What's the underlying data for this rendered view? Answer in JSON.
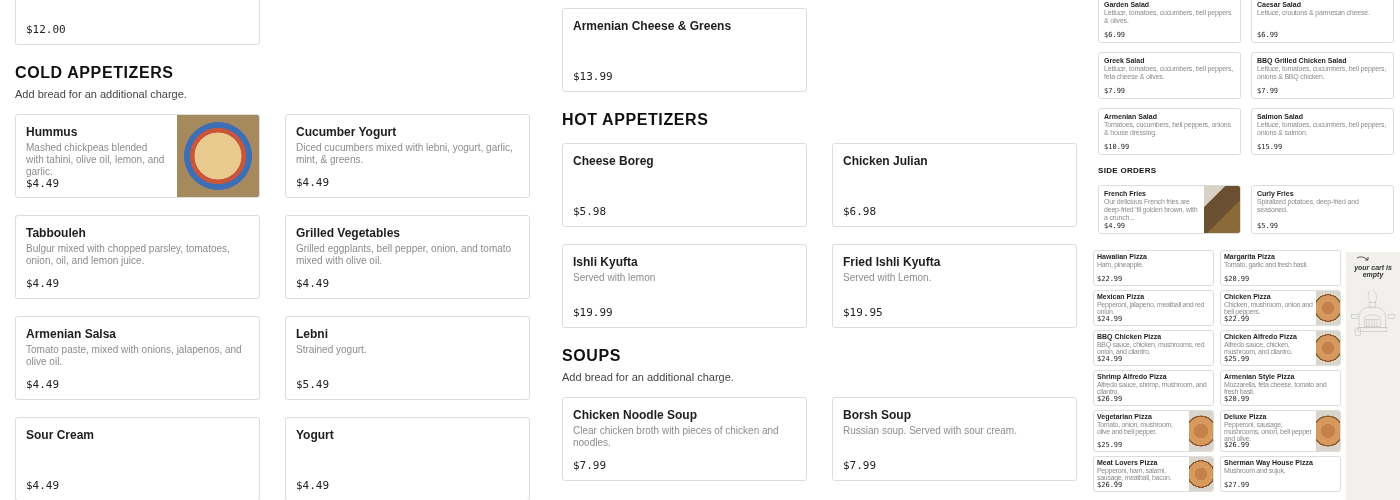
{
  "left_column": [
    {
      "items": [
        {
          "price": "$12.00",
          "photo": false
        }
      ]
    },
    {
      "heading": "COLD APPETIZERS",
      "note": "Add bread for an additional charge.",
      "items": [
        {
          "name": "Hummus",
          "description": "Mashed chickpeas blended with tahini, olive oil, lemon, and garlic.",
          "price": "$4.49",
          "photo": true
        },
        {
          "name": "Cucumber Yogurt",
          "description": "Diced cucumbers mixed with lebni, yogurt, garlic, mint, & greens.",
          "price": "$4.49",
          "photo": false
        },
        {
          "name": "Tabbouleh",
          "description": "Bulgur mixed with chopped parsley, tomatoes, onion, oil, and lemon juice.",
          "price": "$4.49",
          "photo": false
        },
        {
          "name": "Grilled Vegetables",
          "description": "Grilled eggplants, bell pepper, onion, and tomato mixed with olive oil.",
          "price": "$4.49",
          "photo": false
        },
        {
          "name": "Armenian Salsa",
          "description": "Tomato paste, mixed with onions, jalapenos, and olive oil.",
          "price": "$4.49",
          "photo": false
        },
        {
          "name": "Lebni",
          "description": "Strained yogurt.",
          "price": "$5.49",
          "photo": false
        },
        {
          "name": "Sour Cream",
          "price": "$4.49",
          "photo": false
        },
        {
          "name": "Yogurt",
          "price": "$4.49",
          "photo": false
        }
      ]
    }
  ],
  "middle_column": [
    {
      "items": [
        {
          "name": "Armenian Cheese & Greens",
          "price": "$13.99",
          "photo": false
        }
      ]
    },
    {
      "heading": "HOT APPETIZERS",
      "items": [
        {
          "name": "Cheese Boreg",
          "price": "$5.98",
          "photo": false
        },
        {
          "name": "Chicken Julian",
          "price": "$6.98",
          "photo": false
        },
        {
          "name": "Ishli Kyufta",
          "description": "Served with lemon",
          "price": "$19.99",
          "photo": false
        },
        {
          "name": "Fried Ishli Kyufta",
          "description": "Served with Lemon.",
          "price": "$19.95",
          "photo": false
        }
      ]
    },
    {
      "heading": "SOUPS",
      "note": "Add bread for an additional charge.",
      "items": [
        {
          "name": "Chicken Noodle Soup",
          "description": "Clear chicken broth with pieces of chicken and noodles.",
          "price": "$7.99",
          "photo": false
        },
        {
          "name": "Borsh Soup",
          "description": "Russian soup. Served with sour cream.",
          "price": "$7.99",
          "photo": false
        }
      ]
    }
  ],
  "salads_preview": [
    {
      "items": [
        {
          "name": "Garden Salad",
          "description": "Lettuce, tomatoes, cucumbers, bell peppers & olives.",
          "price": "$6.99",
          "photo": false
        },
        {
          "name": "Caesar Salad",
          "description": "Lettuce, croutons & parmesan cheese.",
          "price": "$6.99",
          "photo": false
        },
        {
          "name": "Greek Salad",
          "description": "Lettuce, tomatoes, cucumbers, bell peppers, feta cheese & olives.",
          "price": "$7.99",
          "photo": false
        },
        {
          "name": "BBQ Grilled Chicken Salad",
          "description": "Lettuce, tomatoes, cucumbers, bell peppers, onions & BBQ chicken.",
          "price": "$7.99",
          "photo": false
        },
        {
          "name": "Armenian Salad",
          "description": "Tomatoes, cucumbers, bell peppers, onions & house dressing.",
          "price": "$10.99",
          "photo": false
        },
        {
          "name": "Salmon Salad",
          "description": "Lettuce, tomatoes, cucumbers, bell peppers, onions & salmon.",
          "price": "$15.99",
          "photo": false
        }
      ]
    },
    {
      "heading": "SIDE ORDERS",
      "items": [
        {
          "name": "French Fries",
          "description": "Our delicious French fries are deep-fried 'til golden brown, with a crunch...",
          "price": "$4.99",
          "photo": true
        },
        {
          "name": "Curly Fries",
          "description": "Spiralized potatoes, deep-fried and seasoned.",
          "price": "$5.99",
          "photo": false
        }
      ]
    }
  ],
  "pizza_preview": [
    {
      "items": [
        {
          "name": "Hawaiian Pizza",
          "description": "Ham, pineapple.",
          "price": "$22.99",
          "photo": false
        },
        {
          "name": "Margarita Pizza",
          "description": "Tomato, garlic and fresh basil.",
          "price": "$20.99",
          "photo": false
        },
        {
          "name": "Mexican Pizza",
          "description": "Pepperoni, jalapeno, meatball and red onion.",
          "price": "$24.99",
          "photo": false
        },
        {
          "name": "Chicken Pizza",
          "description": "Chicken, mushroom, onion and bell peppers.",
          "price": "$22.99",
          "photo": true
        },
        {
          "name": "BBQ Chicken Pizza",
          "description": "BBQ sauce, chicken, mushrooms, red onion, and cilantro.",
          "price": "$24.99",
          "photo": false
        },
        {
          "name": "Chicken Alfredo Pizza",
          "description": "Alfredo sauce, chicken, mushroom, and cilantro.",
          "price": "$25.99",
          "photo": true
        },
        {
          "name": "Shrimp Alfredo Pizza",
          "description": "Alfredo sauce, shrimp, mushroom, and cilantro.",
          "price": "$26.99",
          "photo": false
        },
        {
          "name": "Armenian Style Pizza",
          "description": "Mozzarella, feta cheese, tomato and fresh basil.",
          "price": "$20.99",
          "photo": false
        },
        {
          "name": "Vegetarian Pizza",
          "description": "Tomato, onion, mushroom, olive and bell pepper.",
          "price": "$25.99",
          "photo": true
        },
        {
          "name": "Deluxe Pizza",
          "description": "Pepperoni, sausage, mushrooms, onion, bell pepper and olive.",
          "price": "$26.99",
          "photo": true
        },
        {
          "name": "Meat Lovers Pizza",
          "description": "Pepperoni, ham, salami, sausage, meatball, bacon.",
          "price": "$26.99",
          "photo": true
        },
        {
          "name": "Sherman Way House Pizza",
          "description": "Mushroom and sujuk.",
          "price": "$27.99",
          "photo": false
        }
      ]
    }
  ],
  "cart": {
    "message": "your cart is empty"
  }
}
